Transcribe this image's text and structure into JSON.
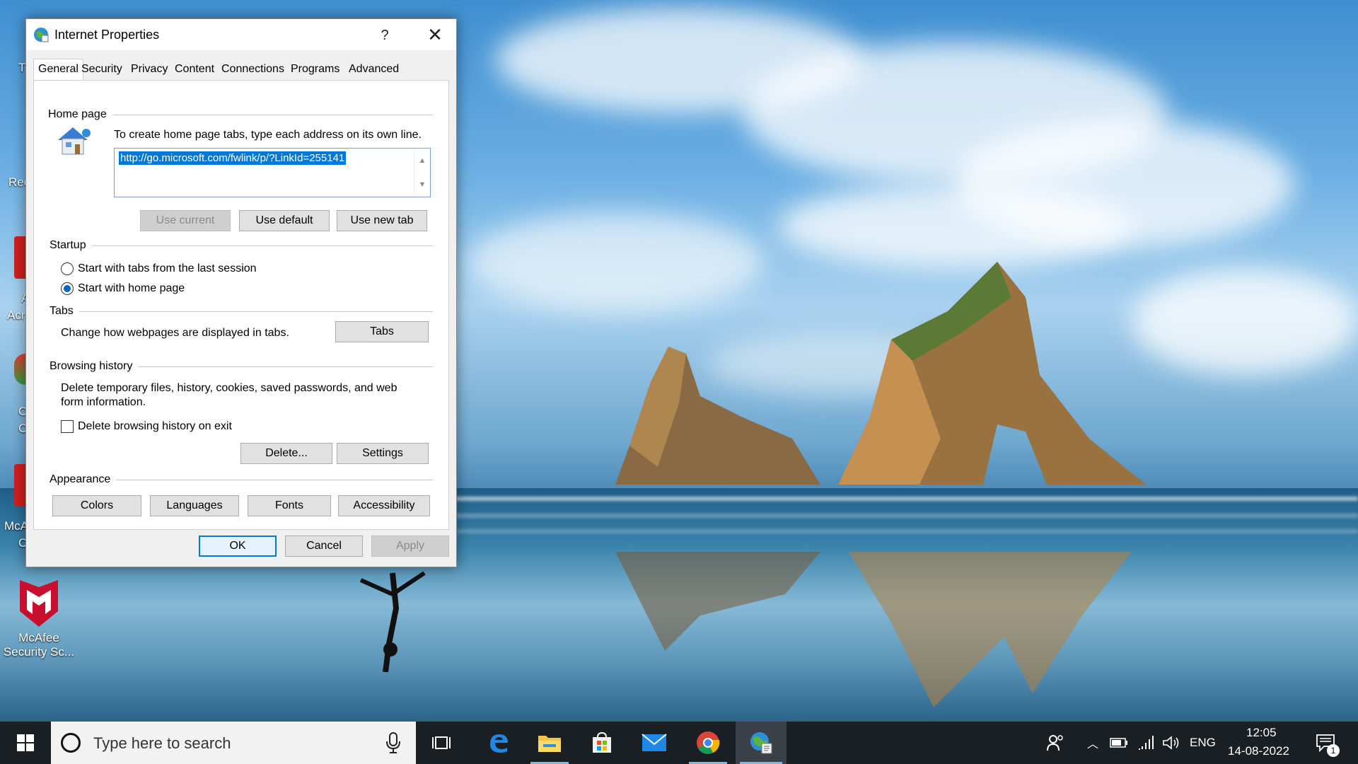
{
  "dialog": {
    "title": "Internet Properties",
    "help_glyph": "?",
    "close_glyph": "✕",
    "tabs": [
      "General",
      "Security",
      "Privacy",
      "Content",
      "Connections",
      "Programs",
      "Advanced"
    ],
    "active_tab": "General",
    "home_page": {
      "group_title": "Home page",
      "instruction": "To create home page tabs, type each address on its own line.",
      "url": "http://go.microsoft.com/fwlink/p/?LinkId=255141",
      "buttons": {
        "use_current": "Use current",
        "use_default": "Use default",
        "use_new_tab": "Use new tab"
      }
    },
    "startup": {
      "group_title": "Startup",
      "option_last_session": "Start with tabs from the last session",
      "option_home_page": "Start with home page",
      "selected": "home_page"
    },
    "tabs_group": {
      "group_title": "Tabs",
      "description": "Change how webpages are displayed in tabs.",
      "button": "Tabs"
    },
    "browsing_history": {
      "group_title": "Browsing history",
      "description_line1": "Delete temporary files, history, cookies, saved passwords, and web",
      "description_line2": "form information.",
      "checkbox_label": "Delete browsing history on exit",
      "checkbox_checked": false,
      "delete_button": "Delete...",
      "settings_button": "Settings"
    },
    "appearance": {
      "group_title": "Appearance",
      "colors": "Colors",
      "languages": "Languages",
      "fonts": "Fonts",
      "accessibility": "Accessibility"
    },
    "footer": {
      "ok": "OK",
      "cancel": "Cancel",
      "apply": "Apply"
    }
  },
  "desktop": {
    "icons": [
      {
        "label_line1": "McAfee",
        "label_line2": "Security Sc..."
      }
    ],
    "partial_labels": [
      "T",
      "Rec",
      "A",
      "Acr",
      "C",
      "C",
      "McA",
      "C"
    ]
  },
  "taskbar": {
    "search_placeholder": "Type here to search",
    "language": "ENG",
    "time": "12:05",
    "date": "14-08-2022",
    "notification_count": "1",
    "accent_color": "#76b9ed"
  }
}
